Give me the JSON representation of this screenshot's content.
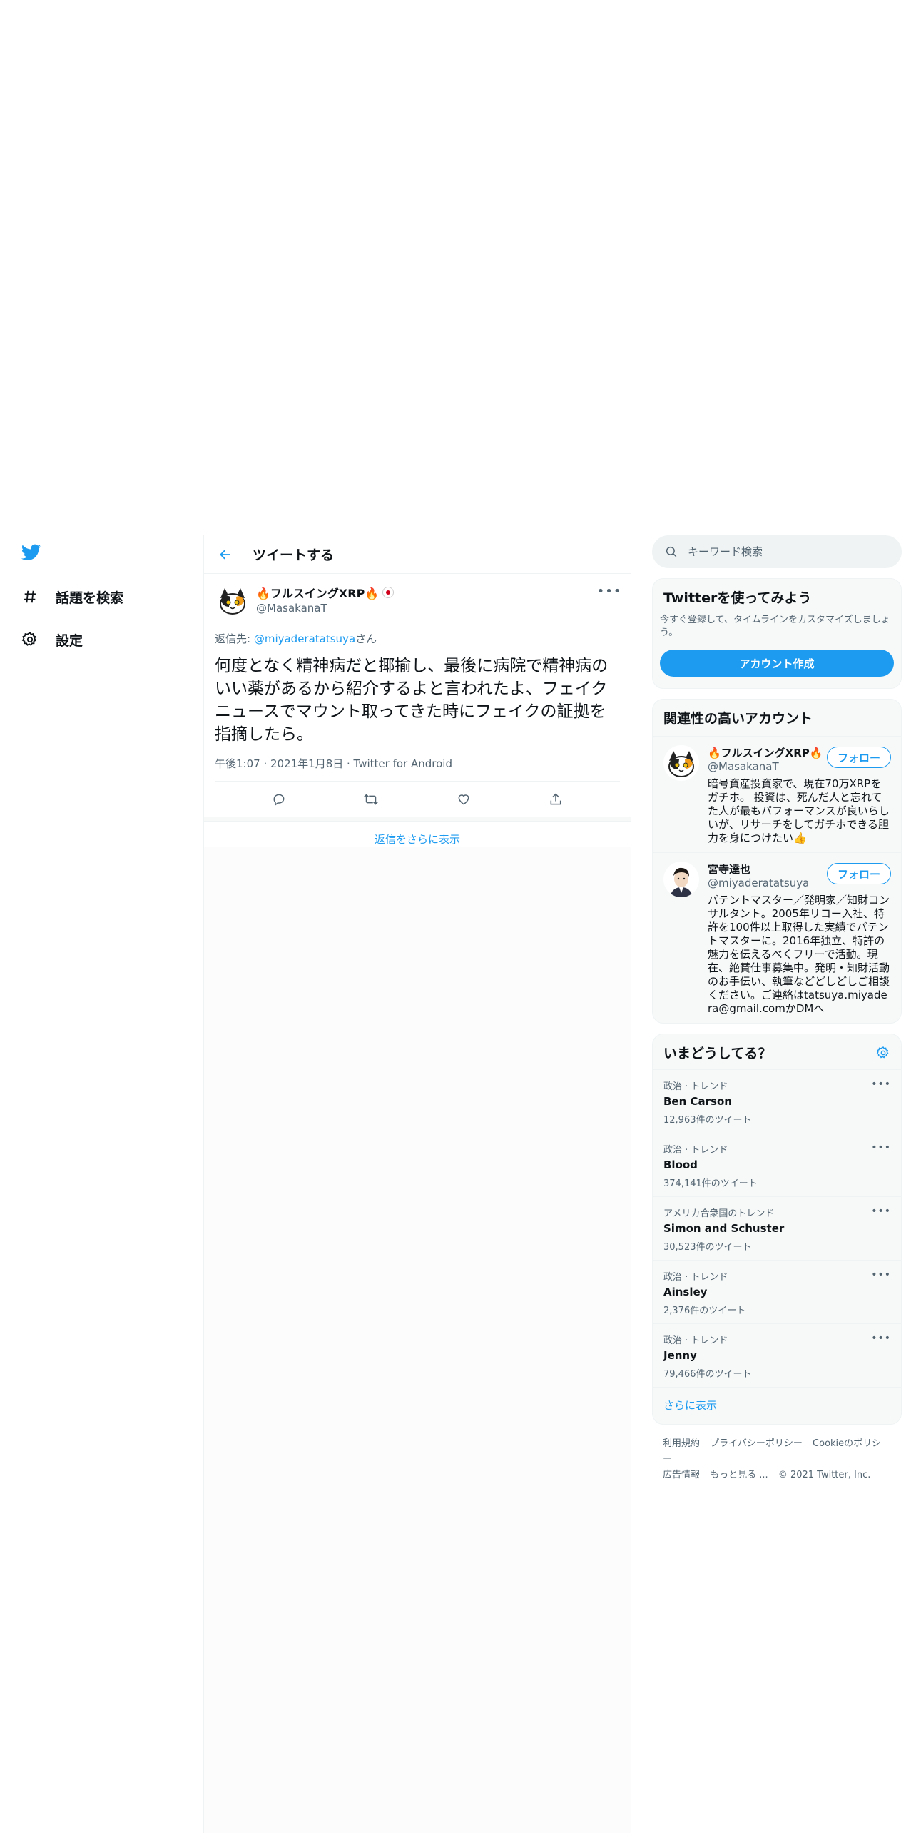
{
  "nav": {
    "items": [
      {
        "label": "話題を検索",
        "icon": "hashtag-icon"
      },
      {
        "label": "設定",
        "icon": "gear-icon"
      }
    ]
  },
  "center": {
    "title": "ツイートする",
    "tweet": {
      "display_name": "🔥フルスイングXRP🔥",
      "handle": "@MasakanaT",
      "reply_prefix": "返信先: ",
      "reply_to": "@miyaderatatsuya",
      "reply_suffix": "さん",
      "text": "何度となく精神病だと揶揄し、最後に病院で精神病のいい薬があるから紹介するよと言われたよ、フェイクニュースでマウント取ってきた時にフェイクの証拠を指摘したら。",
      "meta": "午後1:07 · 2021年1月8日 · Twitter for Android"
    },
    "show_more_replies": "返信をさらに表示"
  },
  "right": {
    "search_placeholder": "キーワード検索",
    "signup": {
      "title": "Twitterを使ってみよう",
      "text": "今すぐ登録して、タイムラインをカスタマイズしましょう。",
      "button": "アカウント作成"
    },
    "related": {
      "title": "関連性の高いアカウント",
      "follow_label": "フォロー",
      "accounts": [
        {
          "name": "🔥フルスイングXRP🔥",
          "handle": "@MasakanaT",
          "bio": "暗号資産投資家で、現在70万XRPをガチホ。 投資は、死んだ人と忘れてた人が最もパフォーマンスが良いらしいが、リサーチをしてガチホできる胆力を身につけたい👍"
        },
        {
          "name": "宮寺達也",
          "handle": "@miyaderatatsuya",
          "bio": "パテントマスター／発明家／知財コンサルタント。2005年リコー入社、特許を100件以上取得した実績でパテントマスターに。2016年独立、特許の魅力を伝えるべくフリーで活動。現在、絶賛仕事募集中。発明・知財活動のお手伝い、執筆などどしどしご相談ください。ご連絡はtatsuya.miyadera@gmail.comかDMへ"
        }
      ]
    },
    "trends": {
      "title": "いまどうしてる？",
      "items": [
        {
          "category": "政治 · トレンド",
          "name": "Ben Carson",
          "count": "12,963件のツイート"
        },
        {
          "category": "政治 · トレンド",
          "name": "Blood",
          "count": "374,141件のツイート"
        },
        {
          "category": "アメリカ合衆国のトレンド",
          "name": "Simon and Schuster",
          "count": "30,523件のツイート"
        },
        {
          "category": "政治 · トレンド",
          "name": "Ainsley",
          "count": "2,376件のツイート"
        },
        {
          "category": "政治 · トレンド",
          "name": "Jenny",
          "count": "79,466件のツイート"
        }
      ],
      "show_more": "さらに表示"
    },
    "footer": {
      "links": [
        "利用規約",
        "プライバシーポリシー",
        "Cookieのポリシー",
        "広告情報",
        "もっと見る ..."
      ],
      "copyright": "© 2021 Twitter, Inc."
    }
  },
  "colors": {
    "accent": "#1d9bf0",
    "text": "#0f1419",
    "muted": "#536471",
    "border": "#eff3f4"
  }
}
